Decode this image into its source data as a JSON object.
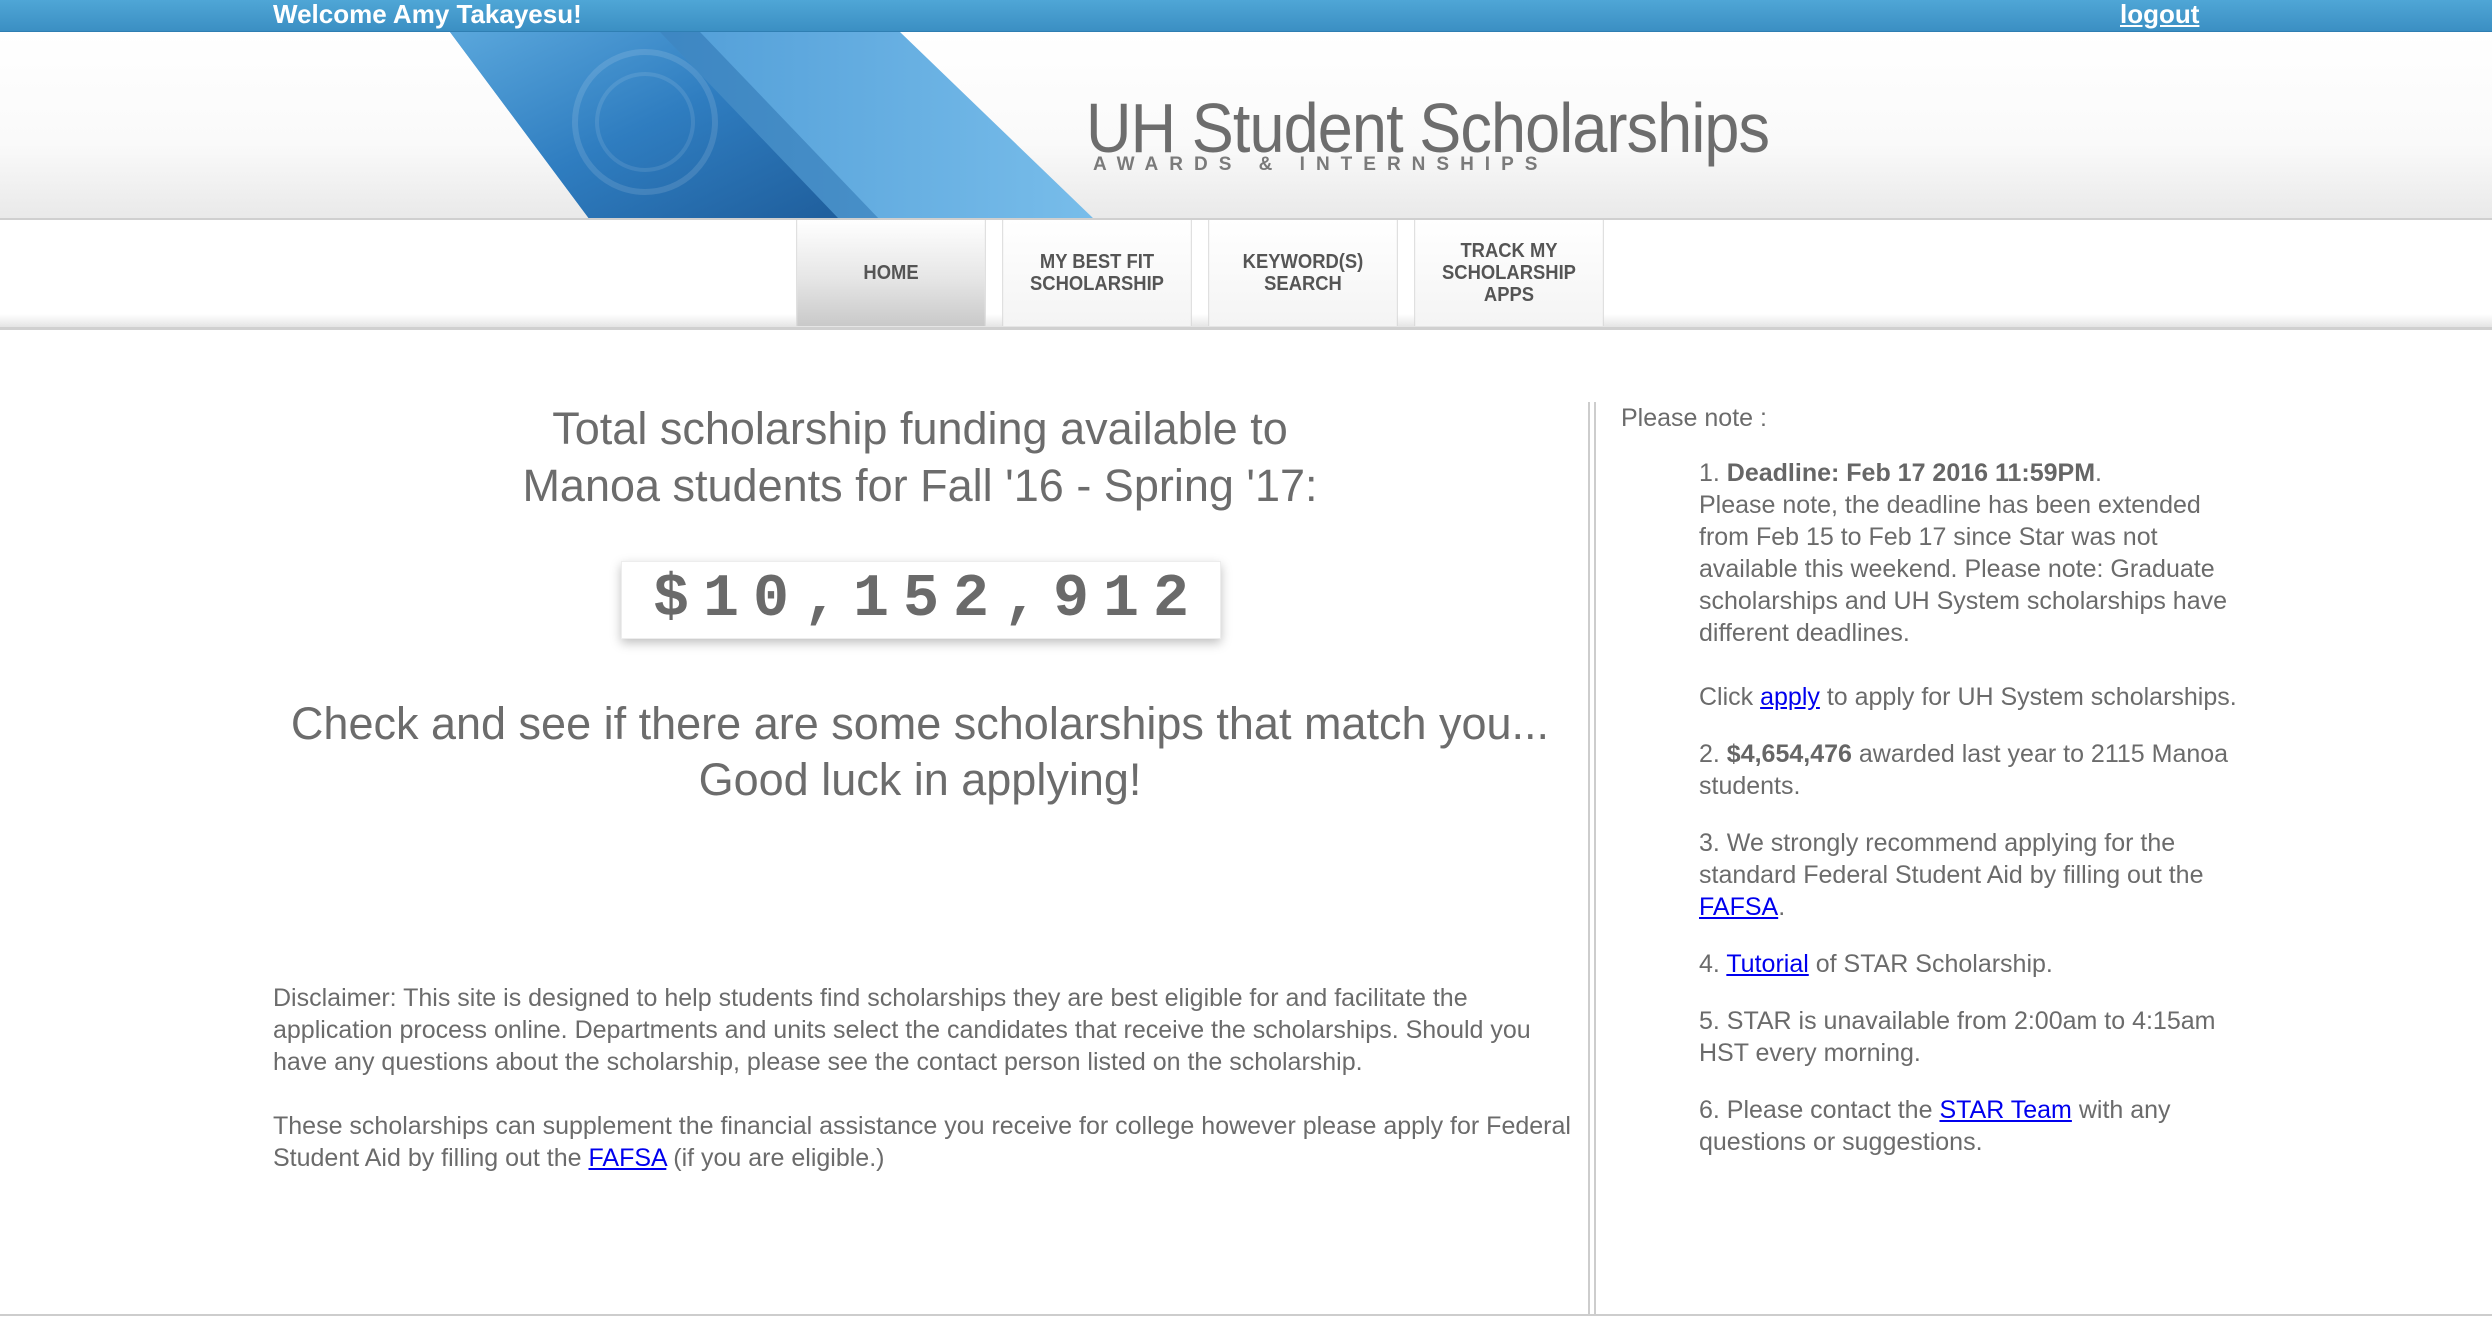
{
  "topbar": {
    "welcome": "Welcome Amy Takayesu!",
    "logout": "logout"
  },
  "brand": {
    "title": "UH Student Scholarships",
    "subtitle": "AWARDS & INTERNSHIPS"
  },
  "nav": {
    "items": [
      {
        "label": "HOME"
      },
      {
        "label": "MY BEST FIT\nSCHOLARSHIP"
      },
      {
        "label": "KEYWORD(S)\nSEARCH"
      },
      {
        "label": "TRACK MY\nSCHOLARSHIP\nAPPS"
      }
    ]
  },
  "main": {
    "funding_line1": "Total scholarship funding available to",
    "funding_line2": "Manoa students for Fall '16 - Spring '17:",
    "funding_amount": "$10,152,912",
    "check_line1": "Check and see if there are some scholarships that match you...",
    "check_line2": "Good luck in applying!",
    "disclaimer_p1": "Disclaimer: This site is designed to help students find scholarships they are best eligible for and facilitate the application process online. Departments and units select the candidates that receive the scholarships. Should you have any questions about the scholarship, please see the contact person listed on the scholarship.",
    "disclaimer_p2_pre": "These scholarships can supplement the financial assistance you receive for college however please apply for Federal Student Aid by filling out the ",
    "disclaimer_p2_link": "FAFSA",
    "disclaimer_p2_post": " (if you are eligible.)"
  },
  "notes": {
    "heading": "Please note :",
    "n1_num": "1. ",
    "n1_bold": "Deadline: Feb 17 2016 11:59PM",
    "n1_dot": ".",
    "n1_text": "Please note, the deadline has been extended from Feb 15 to Feb 17 since Star was not available this weekend. Please note: Graduate scholarships and UH System scholarships have different deadlines.",
    "n1b_pre": "Click ",
    "n1b_link": "apply",
    "n1b_post": " to apply for UH System scholarships.",
    "n2_num": "2. ",
    "n2_bold": "$4,654,476",
    "n2_text": " awarded last year to 2115 Manoa students.",
    "n3_text": "3. We strongly recommend applying for the standard Federal Student Aid by filling out the ",
    "n3_link": "FAFSA",
    "n3_post": ".",
    "n4_pre": "4. ",
    "n4_link": "Tutorial",
    "n4_post": " of STAR Scholarship.",
    "n5_text": "5. STAR is unavailable from 2:00am to 4:15am HST every morning.",
    "n6_pre": "6. Please contact the ",
    "n6_link": "STAR Team",
    "n6_post": " with any questions or suggestions."
  },
  "colors": {
    "topbar": "#3b8fc3",
    "banner_blue": "#2f7dc0",
    "link": "#0000ee",
    "text": "#6b6b6b"
  }
}
